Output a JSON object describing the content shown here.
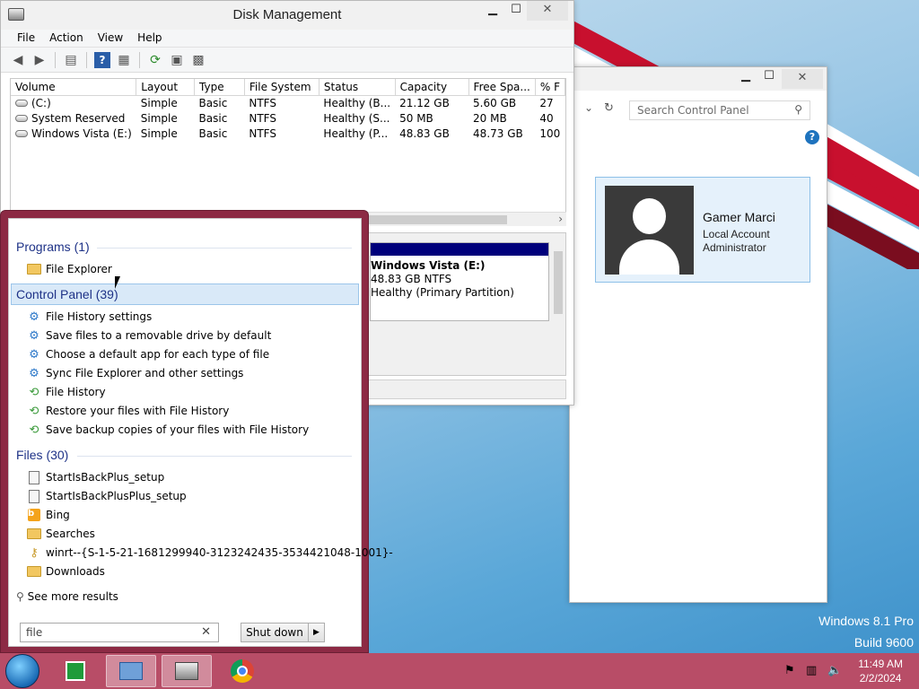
{
  "disk_management": {
    "title": "Disk Management",
    "menu": [
      "File",
      "Action",
      "View",
      "Help"
    ],
    "columns": [
      "Volume",
      "Layout",
      "Type",
      "File System",
      "Status",
      "Capacity",
      "Free Spa...",
      "% F"
    ],
    "rows": [
      {
        "volume": "(C:)",
        "layout": "Simple",
        "type": "Basic",
        "fs": "NTFS",
        "status": "Healthy (B...",
        "capacity": "21.12 GB",
        "free": "5.60 GB",
        "pct": "27"
      },
      {
        "volume": "System Reserved",
        "layout": "Simple",
        "type": "Basic",
        "fs": "NTFS",
        "status": "Healthy (S...",
        "capacity": "50 MB",
        "free": "20 MB",
        "pct": "40"
      },
      {
        "volume": "Windows Vista  (E:)",
        "layout": "Simple",
        "type": "Basic",
        "fs": "NTFS",
        "status": "Healthy (P...",
        "capacity": "48.83 GB",
        "free": "48.73 GB",
        "pct": "100"
      }
    ],
    "partition": {
      "name": "Windows Vista  (E:)",
      "size": "48.83 GB NTFS",
      "status": "Healthy (Primary Partition)"
    }
  },
  "control_panel": {
    "search_placeholder": "Search Control Panel",
    "user": {
      "name": "Gamer Marci",
      "line1": "Local Account",
      "line2": "Administrator"
    }
  },
  "start_menu": {
    "groups": {
      "programs": "Programs (1)",
      "control_panel": "Control Panel (39)",
      "files": "Files (30)"
    },
    "programs": [
      {
        "label": "File Explorer",
        "icon": "folder-icon"
      }
    ],
    "control_panel_items": [
      {
        "label": "File History settings",
        "icon": "gear-icon"
      },
      {
        "label": "Save files to a removable drive by default",
        "icon": "gear-icon"
      },
      {
        "label": "Choose a default app for each type of file",
        "icon": "gear-icon"
      },
      {
        "label": "Sync File Explorer and other settings",
        "icon": "gear-icon"
      },
      {
        "label": "File History",
        "icon": "file-history-icon"
      },
      {
        "label": "Restore your files with File History",
        "icon": "file-history-icon"
      },
      {
        "label": "Save backup copies of your files with File History",
        "icon": "file-history-icon"
      }
    ],
    "files": [
      {
        "label": "StartIsBackPlus_setup",
        "icon": "setup-file-icon"
      },
      {
        "label": "StartIsBackPlusPlus_setup",
        "icon": "setup-file-icon"
      },
      {
        "label": "Bing",
        "icon": "bing-icon"
      },
      {
        "label": "Searches",
        "icon": "searches-folder-icon"
      },
      {
        "label": "winrt--{S-1-5-21-1681299940-3123242435-3534421048-1001}-",
        "icon": "key-icon"
      },
      {
        "label": "Downloads",
        "icon": "downloads-folder-icon"
      }
    ],
    "see_more": "See more results",
    "search_value": "file",
    "shutdown_label": "Shut down"
  },
  "watermark": {
    "line1": "Windows 8.1 Pro",
    "line2": "Build 9600"
  },
  "clock": {
    "time": "11:49 AM",
    "date": "2/2/2024"
  },
  "colors": {
    "taskbar": "#b84d67",
    "start_frame": "#8c2a44",
    "group_header": "#1e3287",
    "highlight": "#d9e9f8"
  }
}
